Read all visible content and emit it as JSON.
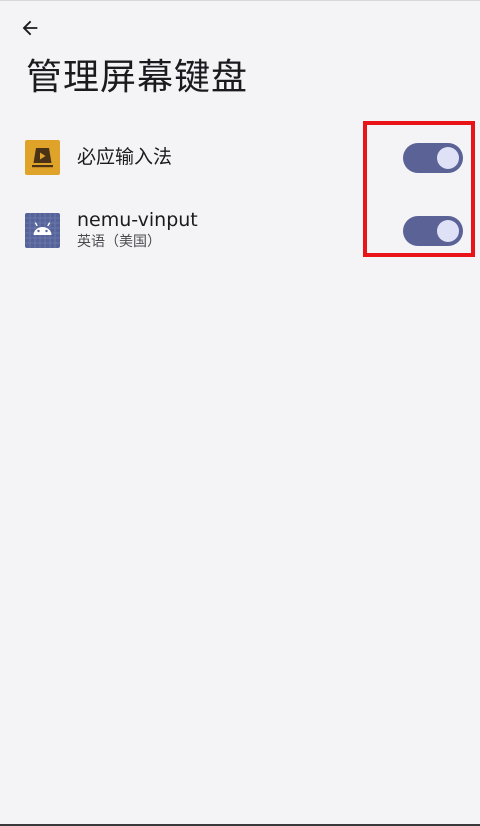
{
  "header": {
    "back_icon": "arrow-left-icon",
    "title": "管理屏幕键盘"
  },
  "keyboards": [
    {
      "name": "必应输入法",
      "subtitle": "",
      "icon": "bing-input-app-icon",
      "icon_color": "#e0a32a",
      "enabled": true
    },
    {
      "name": "nemu-vinput",
      "subtitle": "英语（美国）",
      "icon": "android-app-icon",
      "icon_color": "#566399",
      "enabled": true
    }
  ],
  "colors": {
    "background": "#f4f4f7",
    "switch_track_on": "#5a6296",
    "switch_thumb_on": "#dfe2f6",
    "highlight": "#e81418"
  }
}
